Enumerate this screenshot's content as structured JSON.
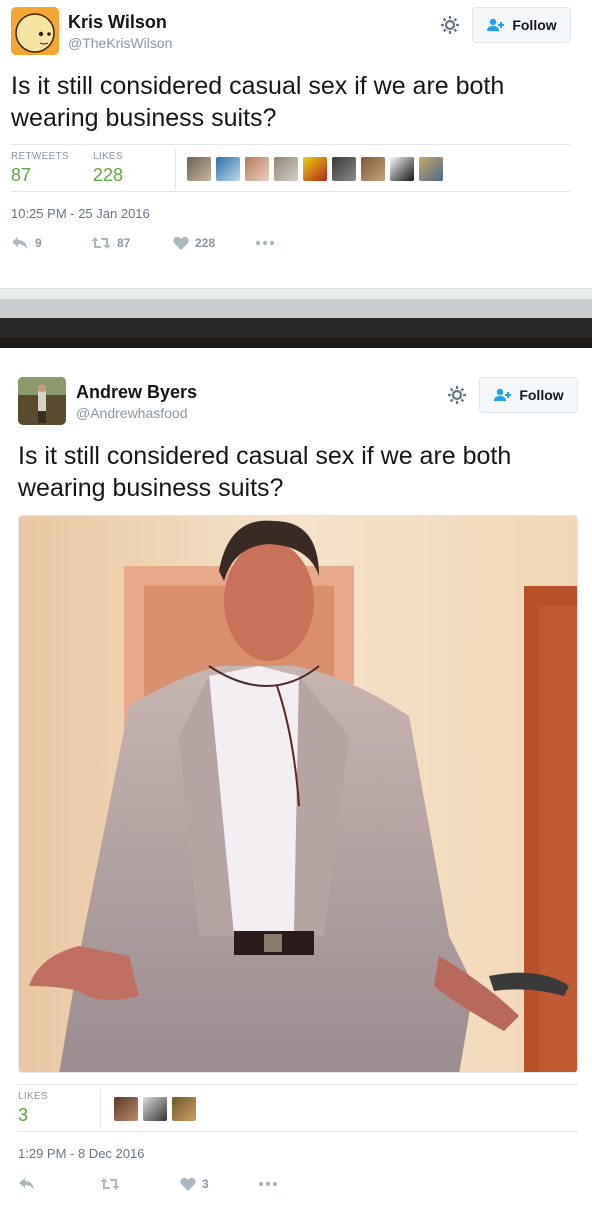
{
  "tweet1": {
    "name": "Kris Wilson",
    "handle": "@TheKrisWilson",
    "follow_label": "Follow",
    "text": "Is it still considered casual sex if we are both wearing business suits?",
    "retweets_label": "RETWEETS",
    "retweets_value": "87",
    "likes_label": "LIKES",
    "likes_value": "228",
    "timestamp": "10:25 PM - 25 Jan 2016",
    "reply_count": "9",
    "retweet_count": "87",
    "like_count": "228"
  },
  "tweet2": {
    "name": "Andrew Byers",
    "handle": "@Andrewhasfood",
    "follow_label": "Follow",
    "text": "Is it still considered casual sex if we are both wearing business suits?",
    "likes_label": "LIKES",
    "likes_value": "3",
    "timestamp": "1:29 PM - 8 Dec 2016",
    "like_count": "3"
  },
  "colors": {
    "accent": "#1da1f2",
    "likes_green": "#5ea83a",
    "muted": "#8899a6"
  },
  "icons": [
    "gear-icon",
    "follow-person-icon",
    "reply-icon",
    "retweet-icon",
    "heart-icon",
    "more-icon"
  ]
}
